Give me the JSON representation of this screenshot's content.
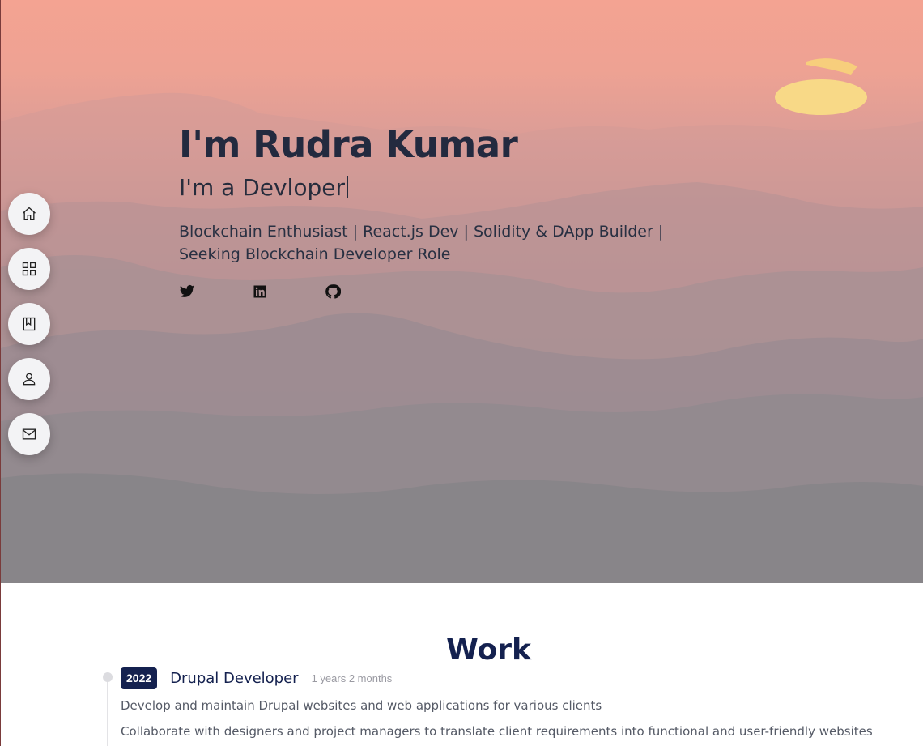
{
  "hero": {
    "title": "I'm Rudra Kumar",
    "typed": "I'm a Devloper",
    "description": "Blockchain Enthusiast | React.js Dev | Solidity & DApp Builder | Seeking Blockchain Developer Role",
    "socials": [
      {
        "icon": "twitter-icon"
      },
      {
        "icon": "linkedin-icon"
      },
      {
        "icon": "github-icon"
      }
    ]
  },
  "sidenav": {
    "items": [
      {
        "icon": "home-icon"
      },
      {
        "icon": "grid-icon"
      },
      {
        "icon": "bookmark-board-icon"
      },
      {
        "icon": "user-icon"
      },
      {
        "icon": "mail-icon"
      }
    ]
  },
  "work": {
    "heading": "Work",
    "jobs": [
      {
        "year": "2022",
        "title": "Drupal Developer",
        "duration": "1 years 2 months",
        "lines": [
          "Develop and maintain Drupal websites and web applications for various clients",
          "Collaborate with designers and project managers to translate client requirements into functional and user-friendly websites"
        ]
      }
    ]
  },
  "colors": {
    "accent": "#14214f",
    "hero_text": "#232a3f"
  }
}
